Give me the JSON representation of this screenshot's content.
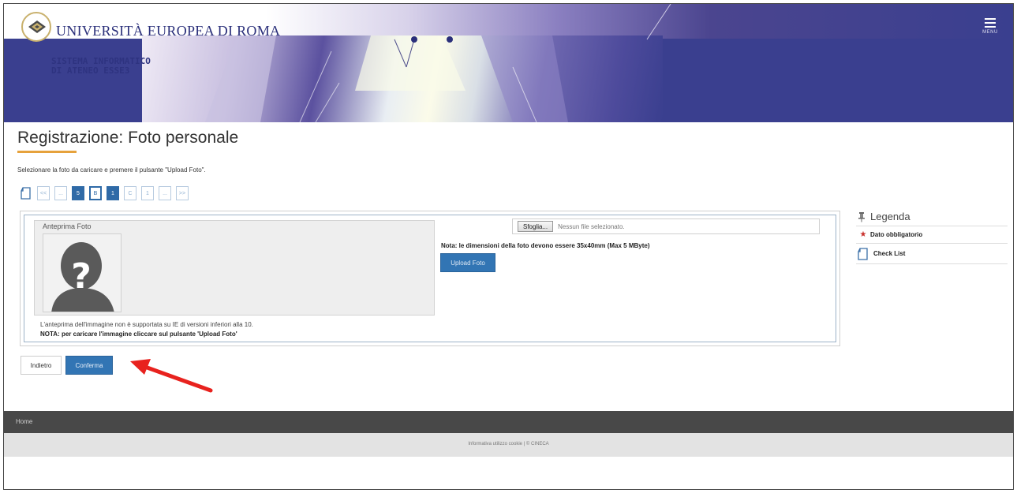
{
  "header": {
    "brand": "UNIVERSITÀ EUROPEA DI ROMA",
    "system_line1": "SISTEMA INFORMATICO",
    "system_line2": "DI ATENEO ESSE3",
    "menu_label": "MENU"
  },
  "page": {
    "title": "Registrazione: Foto personale",
    "instruction": "Selezionare la foto da caricare e premere il pulsante \"Upload Foto\"."
  },
  "wizard": {
    "steps": [
      "<<",
      "...",
      "5",
      "B",
      "1",
      "C",
      "1",
      "...",
      ">>"
    ]
  },
  "preview": {
    "label": "Anteprima Foto",
    "note_ie": "L'anteprima dell'immagine non è supportata su IE di versioni inferiori alla 10.",
    "note_upload": "NOTA: per caricare l'immagine cliccare sul pulsante 'Upload Foto'"
  },
  "file_input": {
    "browse_label": "Sfoglia...",
    "status": "Nessun file selezionato."
  },
  "photo_note": "Nota: le dimensioni della foto devono essere 35x40mm (Max 5 MByte)",
  "upload_button": "Upload Foto",
  "legend": {
    "title": "Legenda",
    "required": "Dato obbligatorio",
    "checklist": "Check List"
  },
  "actions": {
    "back": "Indietro",
    "confirm": "Conferma"
  },
  "footer": {
    "home": "Home",
    "info": "Informativa utilizzo cookie | © CINECA"
  },
  "colors": {
    "primary_button": "#3275b4",
    "header_blue": "#3a3f8f",
    "accent_underline": "#e6a23c",
    "annotation_arrow": "#e8221e"
  }
}
